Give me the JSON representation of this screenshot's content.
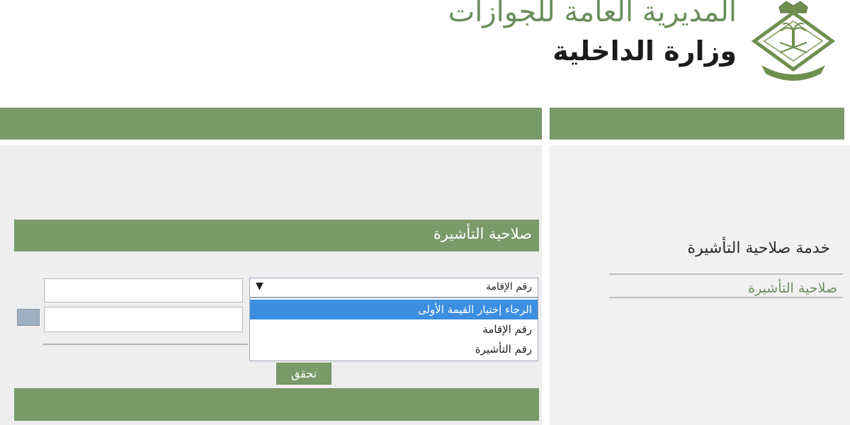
{
  "header": {
    "title_main": "المديرية العامة للجوازات",
    "title_sub": "وزارة الداخلية"
  },
  "form": {
    "header_label": "صلاحية التأشيرة",
    "select_value": "رقم الإقامة",
    "dropdown_options": [
      "الرجاء إختيار القيمة الأولى",
      "رقم الإقامة",
      "رقم التأشيرة"
    ],
    "verify_label": "تحقق"
  },
  "right_panel": {
    "service_title": "خدمة صلاحية التأشيرة",
    "service_link": "صلاحية التأشيرة"
  },
  "colors": {
    "primary_green": "#7a9a6a",
    "selected_blue": "#3b8ee0",
    "panel_grey": "#eeeeef"
  }
}
